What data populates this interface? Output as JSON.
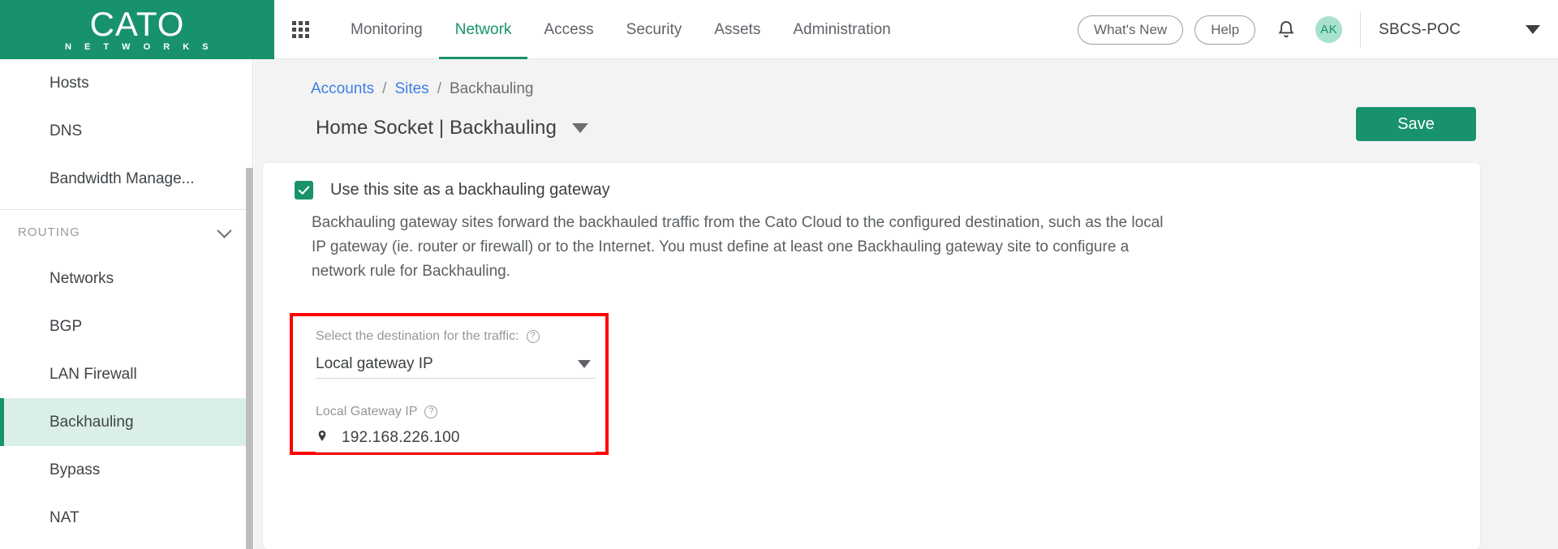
{
  "brand": {
    "name": "CATO",
    "tagline": "N E T W O R K S"
  },
  "topnav": {
    "apps_icon": "grid-apps-icon",
    "items": [
      {
        "label": "Monitoring",
        "active": false
      },
      {
        "label": "Network",
        "active": true
      },
      {
        "label": "Access",
        "active": false
      },
      {
        "label": "Security",
        "active": false
      },
      {
        "label": "Assets",
        "active": false
      },
      {
        "label": "Administration",
        "active": false
      }
    ],
    "whats_new": "What's New",
    "help": "Help",
    "bell_icon": "notification-bell-icon",
    "avatar_initials": "AK",
    "account": "SBCS-POC",
    "account_caret": "chevron-down-icon"
  },
  "sidebar": {
    "items": [
      {
        "label": "Hosts",
        "selected": false
      },
      {
        "label": "DNS",
        "selected": false
      },
      {
        "label": "Bandwidth Manage...",
        "selected": false
      }
    ],
    "group": {
      "label": "ROUTING",
      "chevron": "chevron-down-icon"
    },
    "routing_items": [
      {
        "label": "Networks",
        "selected": false
      },
      {
        "label": "BGP",
        "selected": false
      },
      {
        "label": "LAN Firewall",
        "selected": false
      },
      {
        "label": "Backhauling",
        "selected": true
      },
      {
        "label": "Bypass",
        "selected": false
      },
      {
        "label": "NAT",
        "selected": false
      }
    ]
  },
  "breadcrumb": {
    "accounts": "Accounts",
    "sep1": "/",
    "sites": "Sites",
    "sep2": "/",
    "current": "Backhauling"
  },
  "page": {
    "title": "Home Socket | Backhauling",
    "title_caret": "triangle-down-icon",
    "save_label": "Save"
  },
  "form": {
    "checkbox_checked": true,
    "checkbox_label": "Use this site as a backhauling gateway",
    "description": "Backhauling gateway sites forward the backhauled traffic from the Cato Cloud to the configured destination, such as the local IP gateway (ie. router or firewall) or to the Internet. You must define at least one Backhauling gateway site to configure a network rule for Backhauling.",
    "destination": {
      "label": "Select the destination for the traffic:",
      "help_icon": "help-question-icon",
      "value": "Local gateway IP",
      "caret": "triangle-down-icon"
    },
    "gateway_ip": {
      "label": "Local Gateway IP",
      "help_icon": "help-question-icon",
      "pin_icon": "location-pin-icon",
      "value": "192.168.226.100"
    }
  },
  "colors": {
    "brand_green": "#18926c",
    "accent_link": "#3d7ee8",
    "highlight_red": "#ff0000",
    "selected_row": "#d9efe7"
  }
}
